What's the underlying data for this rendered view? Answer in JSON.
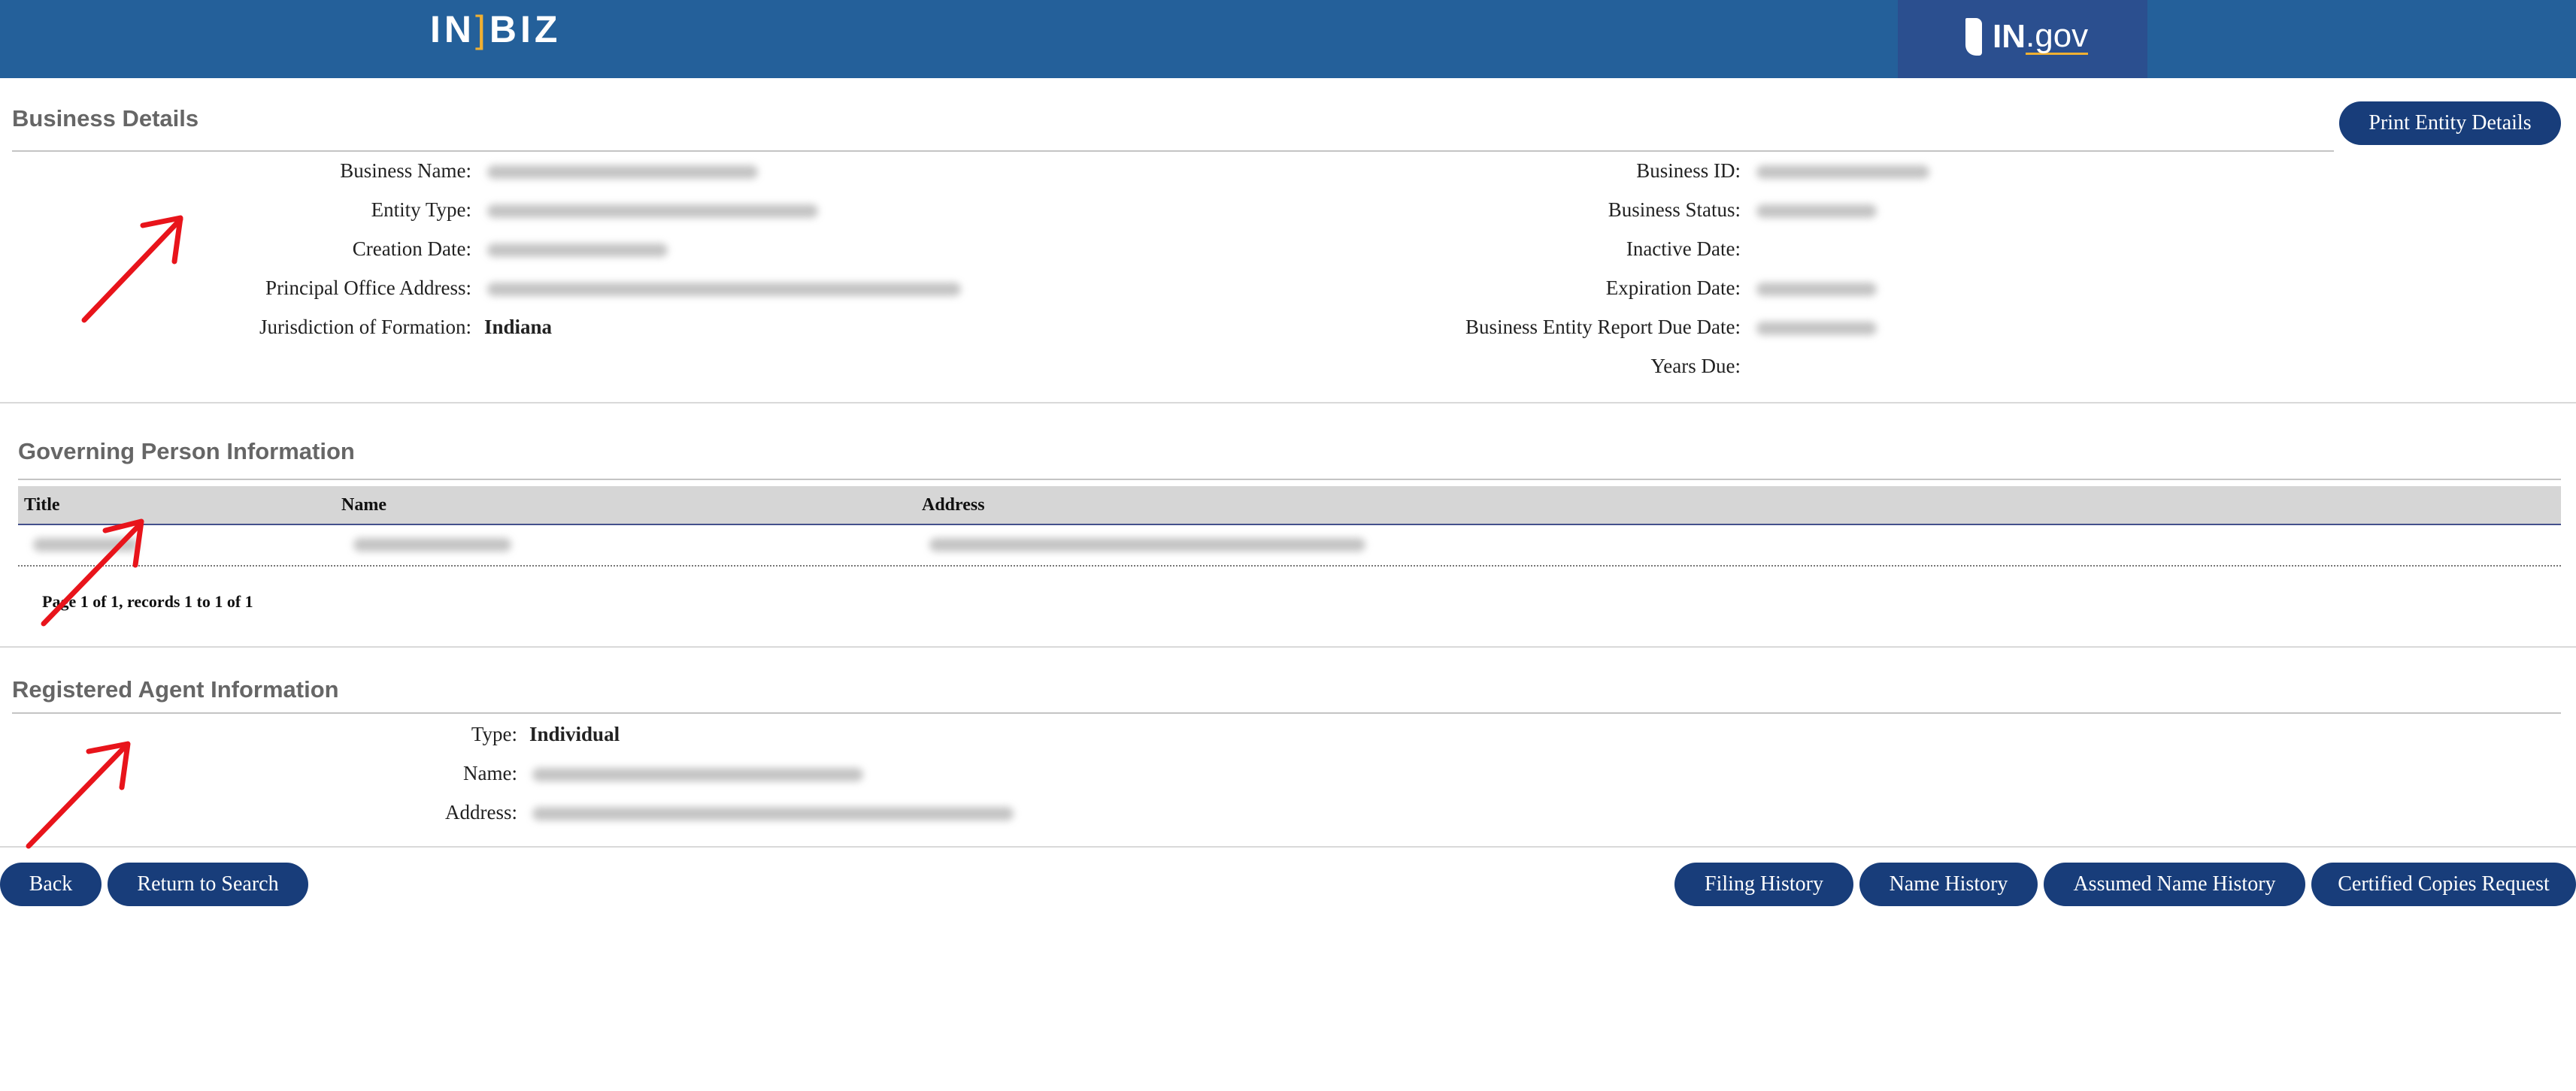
{
  "header": {
    "brand_left": "IN",
    "brand_bracket": "]",
    "brand_right": "BIZ",
    "partner_prefix": "IN",
    "partner_suffix": ".gov"
  },
  "business_details": {
    "title": "Business Details",
    "print_button": "Print Entity Details",
    "left_fields": [
      {
        "label": "Business Name:",
        "value": ""
      },
      {
        "label": "Entity Type:",
        "value": ""
      },
      {
        "label": "Creation Date:",
        "value": ""
      },
      {
        "label": "Principal Office Address:",
        "value": ""
      },
      {
        "label": "Jurisdiction of Formation:",
        "value": "Indiana"
      }
    ],
    "right_fields": [
      {
        "label": "Business ID:",
        "value": ""
      },
      {
        "label": "Business Status:",
        "value": ""
      },
      {
        "label": "Inactive Date:",
        "value": ""
      },
      {
        "label": "Expiration Date:",
        "value": ""
      },
      {
        "label": "Business Entity Report Due Date:",
        "value": ""
      },
      {
        "label": "Years Due:",
        "value": ""
      }
    ]
  },
  "governing": {
    "title": "Governing Person Information",
    "columns": [
      "Title",
      "Name",
      "Address"
    ],
    "pager": "Page 1 of 1, records 1 to 1 of 1"
  },
  "registered_agent": {
    "title": "Registered Agent Information",
    "fields": [
      {
        "label": "Type:",
        "value": "Individual"
      },
      {
        "label": "Name:",
        "value": ""
      },
      {
        "label": "Address:",
        "value": ""
      }
    ]
  },
  "buttons": {
    "back": "Back",
    "return_to_search": "Return to Search",
    "filing_history": "Filing History",
    "name_history": "Name History",
    "assumed_name_history": "Assumed Name History",
    "certified_copies": "Certified Copies Request"
  },
  "colors": {
    "header_bg": "#24609a",
    "button_bg": "#183d7a",
    "annotation_arrow": "#e8141b"
  }
}
